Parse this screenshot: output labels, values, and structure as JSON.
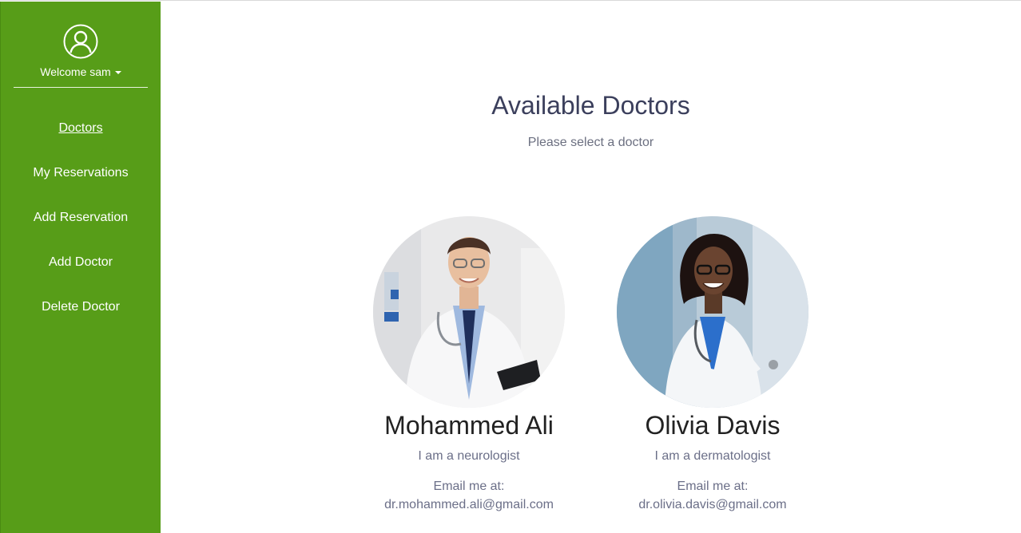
{
  "sidebar": {
    "welcome": "Welcome sam",
    "avatar_icon": "user-circle-icon",
    "items": [
      {
        "label": "Doctors",
        "active": true
      },
      {
        "label": "My Reservations",
        "active": false
      },
      {
        "label": "Add Reservation",
        "active": false
      },
      {
        "label": "Add Doctor",
        "active": false
      },
      {
        "label": "Delete Doctor",
        "active": false
      }
    ]
  },
  "main": {
    "title": "Available Doctors",
    "subtitle": "Please select a doctor",
    "doctors": [
      {
        "name": "Mohammed Ali",
        "specialty": "I am a neurologist",
        "email_label": "Email me at:",
        "email": "dr.mohammed.ali@gmail.com"
      },
      {
        "name": "Olivia Davis",
        "specialty": "I am a dermatologist",
        "email_label": "Email me at:",
        "email": "dr.olivia.davis@gmail.com"
      }
    ]
  },
  "colors": {
    "sidebar_bg": "#579d18",
    "title": "#3b3f5c",
    "muted_text": "#6b6f88"
  }
}
